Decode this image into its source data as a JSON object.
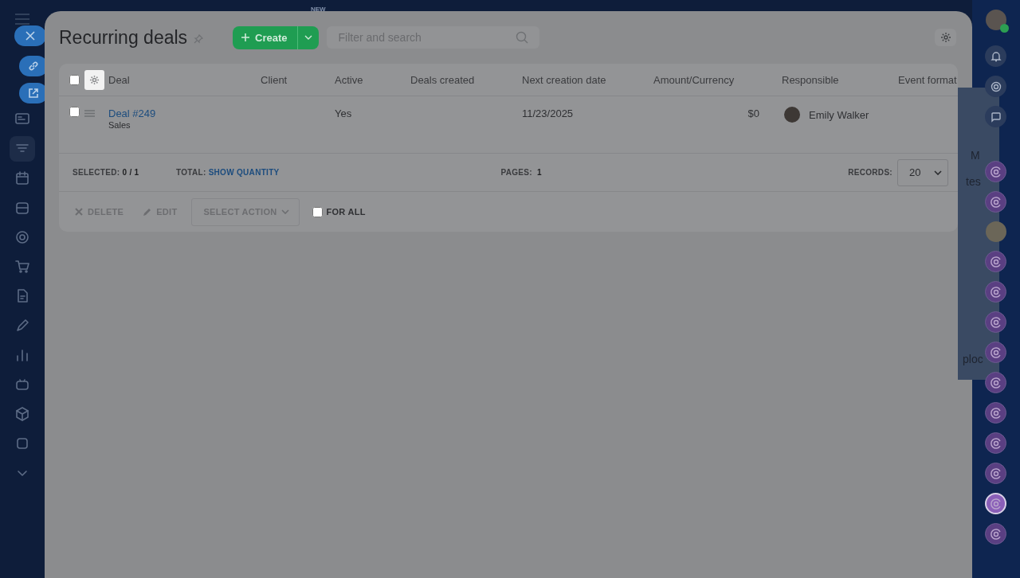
{
  "top_badge": "NEW",
  "page": {
    "title": "Recurring deals",
    "create_button": "Create",
    "search": {
      "placeholder": "Filter and search"
    }
  },
  "table": {
    "select_all_checked": false,
    "columns": [
      "Deal",
      "Client",
      "Active",
      "Deals created",
      "Next creation date",
      "Amount/Currency",
      "Responsible",
      "Event format"
    ],
    "rows": [
      {
        "selected": false,
        "cells": [
          {
            "kind": "link",
            "text": "Deal #249",
            "subtitle": "Sales"
          },
          {
            "kind": "empty"
          },
          {
            "kind": "text",
            "text": "Yes"
          },
          {
            "kind": "empty"
          },
          {
            "kind": "text",
            "text": "11/23/2025"
          },
          {
            "kind": "amount",
            "text": "$0"
          },
          {
            "kind": "person",
            "text": "Emily Walker"
          }
        ]
      }
    ]
  },
  "footer": {
    "selected_label": "SELECTED:",
    "selected_value": "0 / 1",
    "total_label": "TOTAL:",
    "total_link": "SHOW QUANTITY",
    "pages_label": "PAGES:",
    "pages_value": "1",
    "records_label": "RECORDS:",
    "records_value": "20"
  },
  "actions": {
    "delete": "DELETE",
    "edit": "EDIT",
    "select_action": "SELECT ACTION",
    "for_all": {
      "label": "FOR ALL",
      "checked": false
    }
  },
  "background_fragments": [
    "M",
    "tes",
    "ploc"
  ]
}
